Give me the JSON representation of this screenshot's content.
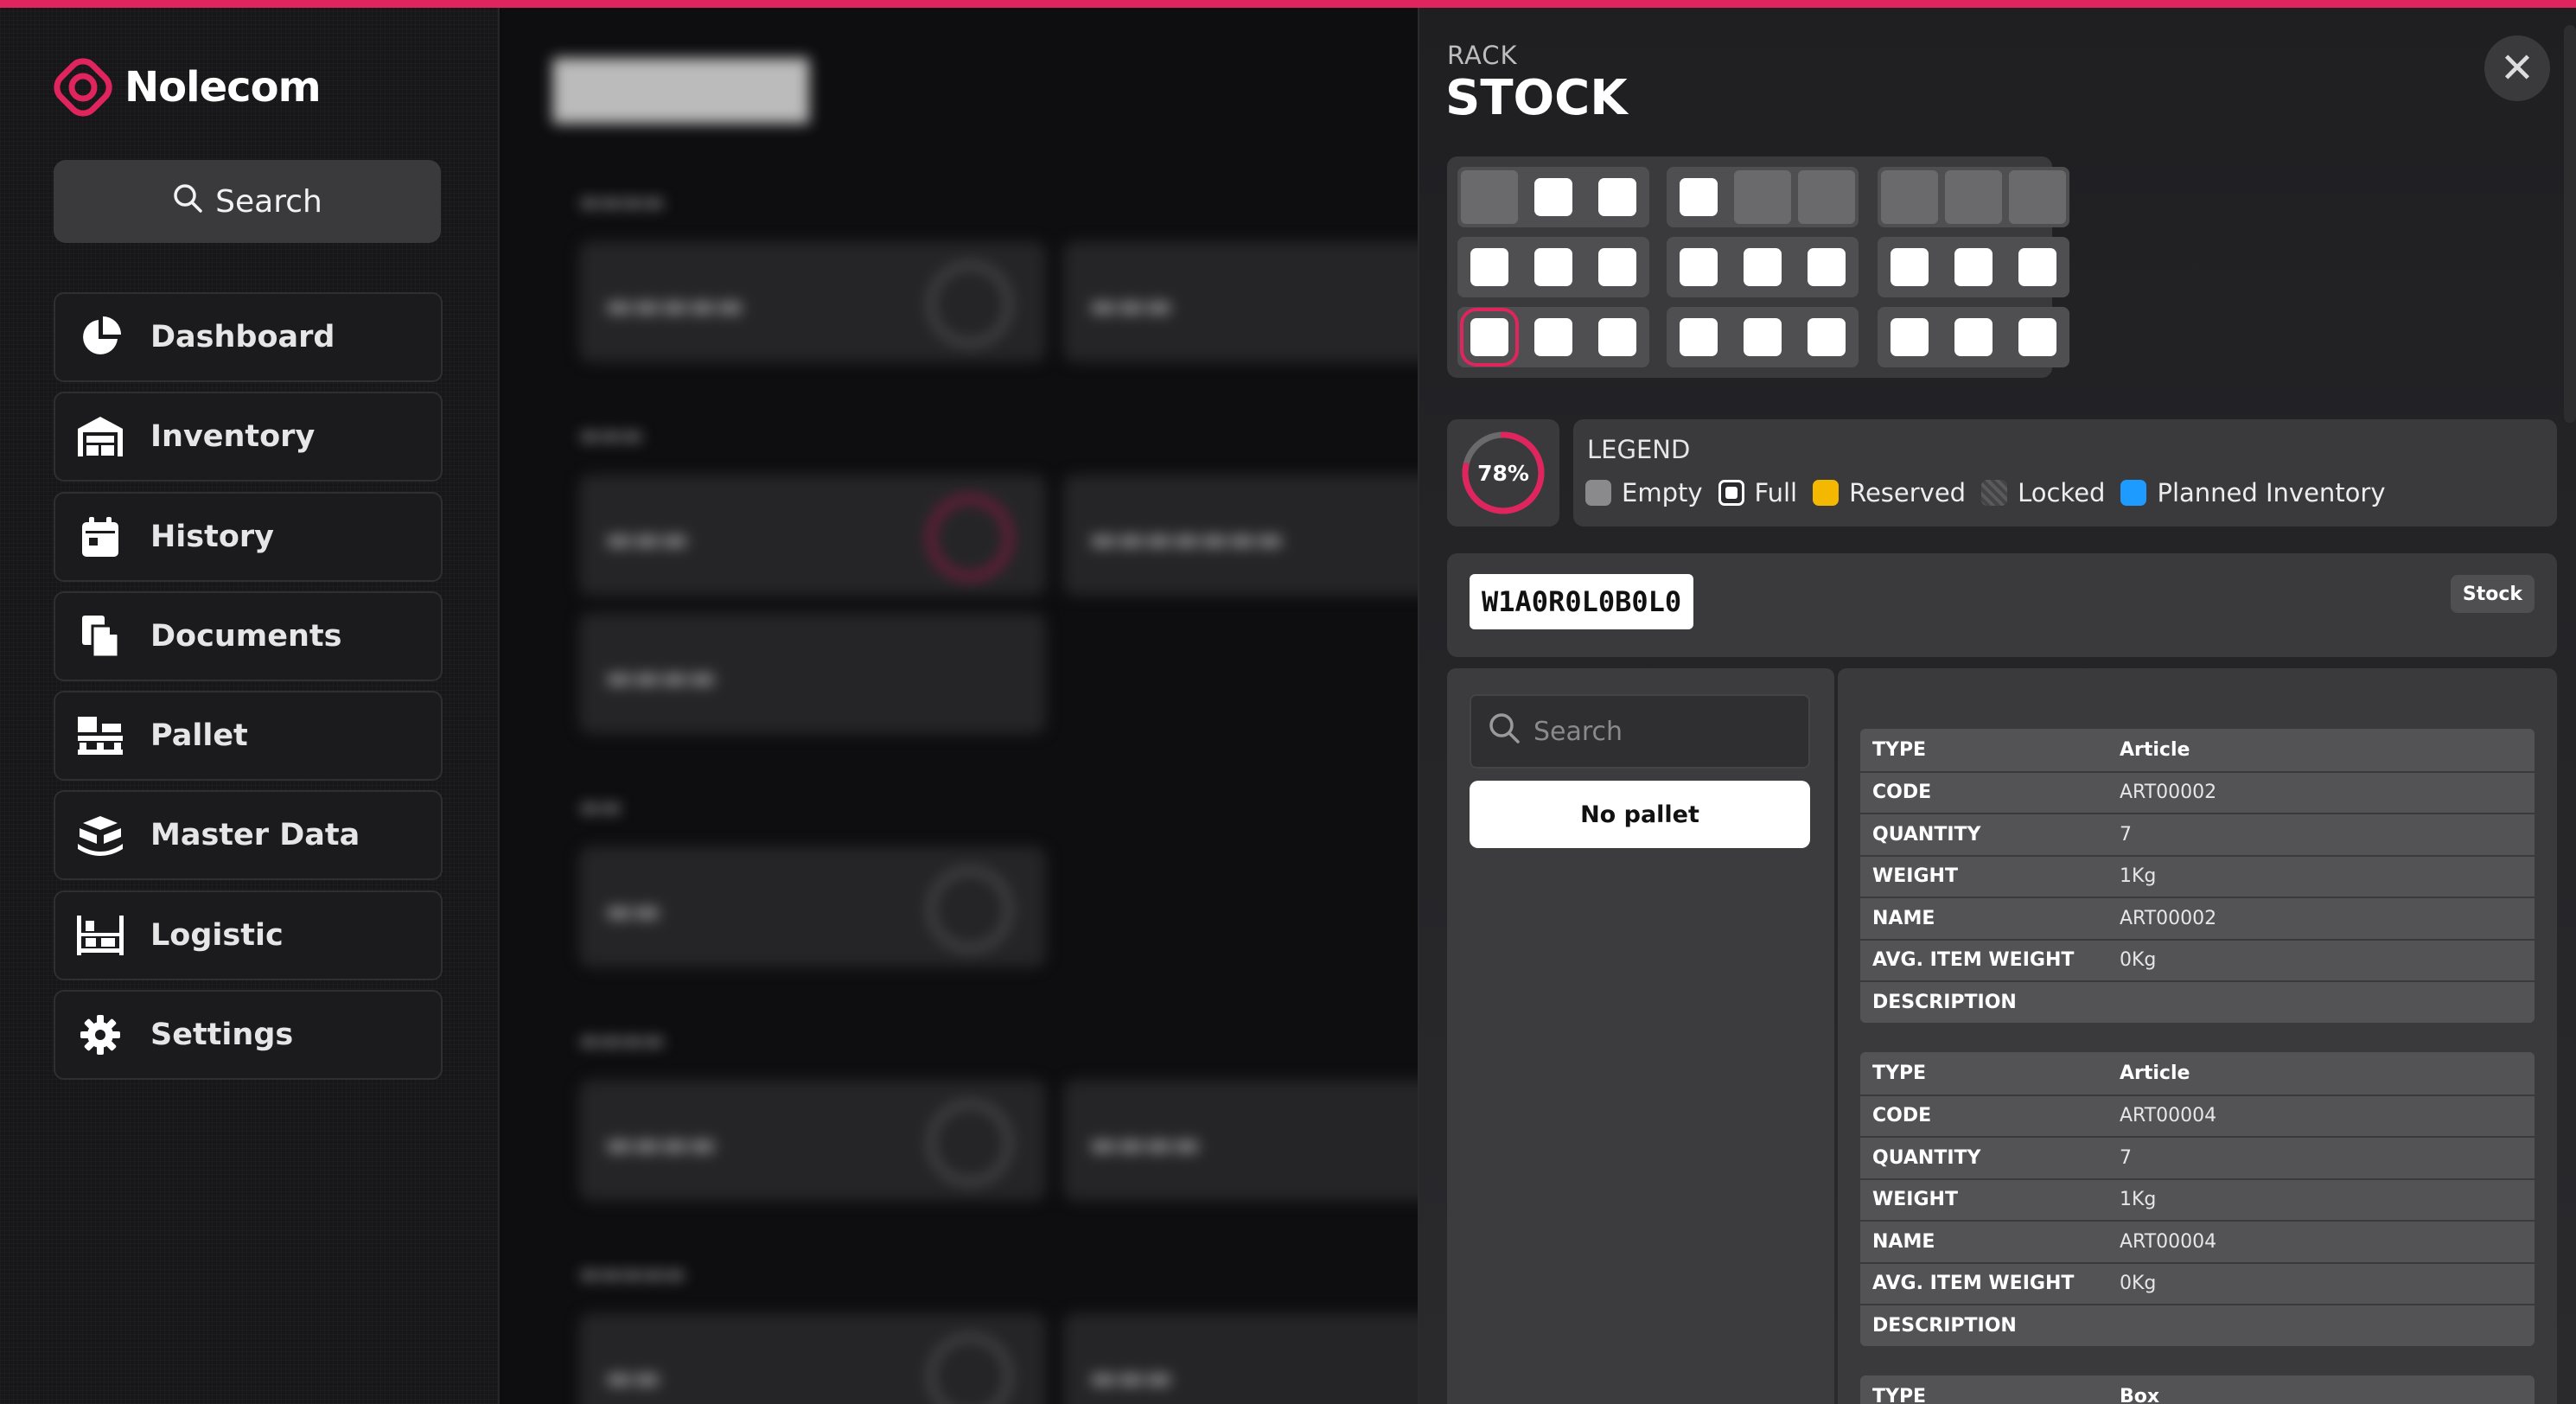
{
  "app": {
    "name": "Nolecom",
    "accent": "#e0245e"
  },
  "sidebar": {
    "search_label": "Search",
    "items": [
      {
        "label": "Dashboard",
        "icon": "pie-chart-icon"
      },
      {
        "label": "Inventory",
        "icon": "warehouse-icon"
      },
      {
        "label": "History",
        "icon": "calendar-icon"
      },
      {
        "label": "Documents",
        "icon": "documents-icon"
      },
      {
        "label": "Pallet",
        "icon": "pallet-icon"
      },
      {
        "label": "Master Data",
        "icon": "boxes-icon"
      },
      {
        "label": "Logistic",
        "icon": "rack-icon"
      },
      {
        "label": "Settings",
        "icon": "gear-icon"
      }
    ]
  },
  "panel": {
    "subtitle": "RACK",
    "title": "STOCK",
    "close_label": "✕",
    "grid": {
      "rows": [
        [
          "empty",
          "full",
          "full",
          "full",
          "empty",
          "empty",
          "empty",
          "empty",
          "empty"
        ],
        [
          "full",
          "full",
          "full",
          "full",
          "full",
          "full",
          "full",
          "full",
          "full"
        ],
        [
          "full",
          "full",
          "full",
          "full",
          "full",
          "full",
          "full",
          "full",
          "full"
        ]
      ],
      "selected": [
        2,
        0
      ]
    },
    "occupancy": {
      "value": 78,
      "label": "78%"
    },
    "legend": {
      "title": "LEGEND",
      "items": [
        {
          "label": "Empty",
          "color": "#8a8a8d"
        },
        {
          "label": "Full",
          "color": "#ffffff"
        },
        {
          "label": "Reserved",
          "color": "#f5b800"
        },
        {
          "label": "Locked",
          "color": "#555558"
        },
        {
          "label": "Planned Inventory",
          "color": "#1e9bff"
        }
      ]
    },
    "location_code": "W1A0R0L0B0L0",
    "status_badge": "Stock",
    "pallet_search_placeholder": "Search",
    "no_pallet_label": "No pallet",
    "records": [
      [
        {
          "k": "TYPE",
          "v": "Article",
          "bold": true
        },
        {
          "k": "CODE",
          "v": "ART00002"
        },
        {
          "k": "QUANTITY",
          "v": "7"
        },
        {
          "k": "WEIGHT",
          "v": "1Kg"
        },
        {
          "k": "NAME",
          "v": "ART00002"
        },
        {
          "k": "AVG. ITEM WEIGHT",
          "v": "0Kg"
        },
        {
          "k": "DESCRIPTION",
          "v": ""
        }
      ],
      [
        {
          "k": "TYPE",
          "v": "Article",
          "bold": true
        },
        {
          "k": "CODE",
          "v": "ART00004"
        },
        {
          "k": "QUANTITY",
          "v": "7"
        },
        {
          "k": "WEIGHT",
          "v": "1Kg"
        },
        {
          "k": "NAME",
          "v": "ART00004"
        },
        {
          "k": "AVG. ITEM WEIGHT",
          "v": "0Kg"
        },
        {
          "k": "DESCRIPTION",
          "v": ""
        }
      ],
      [
        {
          "k": "TYPE",
          "v": "Box",
          "bold": true
        }
      ]
    ]
  }
}
